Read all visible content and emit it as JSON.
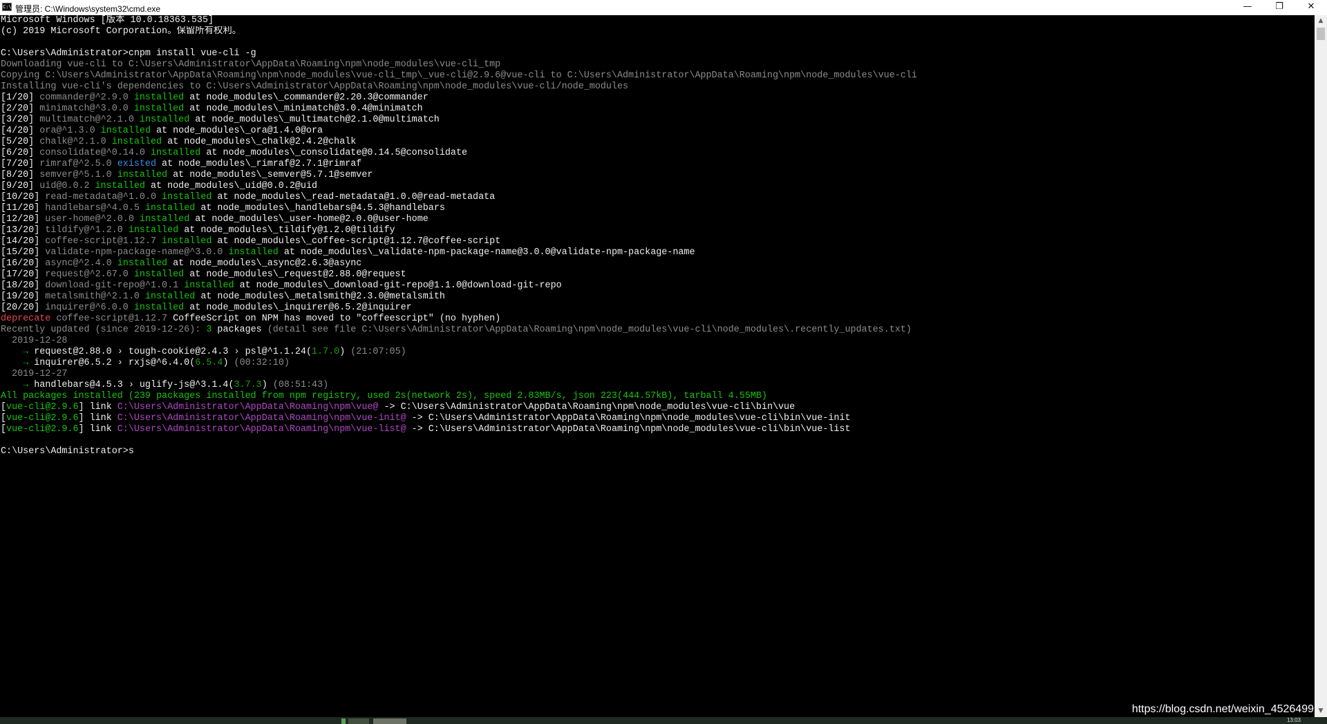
{
  "window": {
    "title": "管理员: C:\\Windows\\system32\\cmd.exe",
    "icon_name": "cmd-icon",
    "icon_glyph": "C:\\",
    "buttons": {
      "minimize": "—",
      "restore": "❐",
      "close": "✕"
    }
  },
  "colors": {
    "background": "#000000",
    "text_gray": "#8c8c8c",
    "text_white": "#f0f0f0",
    "green": "#16c60c",
    "blue": "#3b8eea",
    "red": "#e74856",
    "magenta": "#b148c6"
  },
  "console_lines": [
    [
      [
        "w",
        "Microsoft Windows [版本 10.0.18363.535]"
      ]
    ],
    [
      [
        "w",
        "(c) 2019 Microsoft Corporation。保留所有权利。"
      ]
    ],
    [],
    [
      [
        "w",
        "C:\\Users\\Administrator>cnpm install vue-cli -g"
      ]
    ],
    [
      [
        "d",
        "Downloading vue-cli to C:\\Users\\Administrator\\AppData\\Roaming\\npm\\node_modules\\vue-cli_tmp"
      ]
    ],
    [
      [
        "d",
        "Copying C:\\Users\\Administrator\\AppData\\Roaming\\npm\\node_modules\\vue-cli_tmp\\_vue-cli@2.9.6@vue-cli to C:\\Users\\Administrator\\AppData\\Roaming\\npm\\node_modules\\vue-cli"
      ]
    ],
    [
      [
        "d",
        "Installing vue-cli's dependencies to C:\\Users\\Administrator\\AppData\\Roaming\\npm\\node_modules\\vue-cli/node_modules"
      ]
    ],
    [
      [
        "w",
        "[1/20] "
      ],
      [
        "d",
        "commander@^2.9.0 "
      ],
      [
        "g",
        "installed"
      ],
      [
        "w",
        " at node_modules\\_commander@2.20.3@commander"
      ]
    ],
    [
      [
        "w",
        "[2/20] "
      ],
      [
        "d",
        "minimatch@^3.0.0 "
      ],
      [
        "g",
        "installed"
      ],
      [
        "w",
        " at node_modules\\_minimatch@3.0.4@minimatch"
      ]
    ],
    [
      [
        "w",
        "[3/20] "
      ],
      [
        "d",
        "multimatch@^2.1.0 "
      ],
      [
        "g",
        "installed"
      ],
      [
        "w",
        " at node_modules\\_multimatch@2.1.0@multimatch"
      ]
    ],
    [
      [
        "w",
        "[4/20] "
      ],
      [
        "d",
        "ora@^1.3.0 "
      ],
      [
        "g",
        "installed"
      ],
      [
        "w",
        " at node_modules\\_ora@1.4.0@ora"
      ]
    ],
    [
      [
        "w",
        "[5/20] "
      ],
      [
        "d",
        "chalk@^2.1.0 "
      ],
      [
        "g",
        "installed"
      ],
      [
        "w",
        " at node_modules\\_chalk@2.4.2@chalk"
      ]
    ],
    [
      [
        "w",
        "[6/20] "
      ],
      [
        "d",
        "consolidate@^0.14.0 "
      ],
      [
        "g",
        "installed"
      ],
      [
        "w",
        " at node_modules\\_consolidate@0.14.5@consolidate"
      ]
    ],
    [
      [
        "w",
        "[7/20] "
      ],
      [
        "d",
        "rimraf@^2.5.0 "
      ],
      [
        "b",
        "existed"
      ],
      [
        "w",
        " at node_modules\\_rimraf@2.7.1@rimraf"
      ]
    ],
    [
      [
        "w",
        "[8/20] "
      ],
      [
        "d",
        "semver@^5.1.0 "
      ],
      [
        "g",
        "installed"
      ],
      [
        "w",
        " at node_modules\\_semver@5.7.1@semver"
      ]
    ],
    [
      [
        "w",
        "[9/20] "
      ],
      [
        "d",
        "uid@0.0.2 "
      ],
      [
        "g",
        "installed"
      ],
      [
        "w",
        " at node_modules\\_uid@0.0.2@uid"
      ]
    ],
    [
      [
        "w",
        "[10/20] "
      ],
      [
        "d",
        "read-metadata@^1.0.0 "
      ],
      [
        "g",
        "installed"
      ],
      [
        "w",
        " at node_modules\\_read-metadata@1.0.0@read-metadata"
      ]
    ],
    [
      [
        "w",
        "[11/20] "
      ],
      [
        "d",
        "handlebars@^4.0.5 "
      ],
      [
        "g",
        "installed"
      ],
      [
        "w",
        " at node_modules\\_handlebars@4.5.3@handlebars"
      ]
    ],
    [
      [
        "w",
        "[12/20] "
      ],
      [
        "d",
        "user-home@^2.0.0 "
      ],
      [
        "g",
        "installed"
      ],
      [
        "w",
        " at node_modules\\_user-home@2.0.0@user-home"
      ]
    ],
    [
      [
        "w",
        "[13/20] "
      ],
      [
        "d",
        "tildify@^1.2.0 "
      ],
      [
        "g",
        "installed"
      ],
      [
        "w",
        " at node_modules\\_tildify@1.2.0@tildify"
      ]
    ],
    [
      [
        "w",
        "[14/20] "
      ],
      [
        "d",
        "coffee-script@1.12.7 "
      ],
      [
        "g",
        "installed"
      ],
      [
        "w",
        " at node_modules\\_coffee-script@1.12.7@coffee-script"
      ]
    ],
    [
      [
        "w",
        "[15/20] "
      ],
      [
        "d",
        "validate-npm-package-name@^3.0.0 "
      ],
      [
        "g",
        "installed"
      ],
      [
        "w",
        " at node_modules\\_validate-npm-package-name@3.0.0@validate-npm-package-name"
      ]
    ],
    [
      [
        "w",
        "[16/20] "
      ],
      [
        "d",
        "async@^2.4.0 "
      ],
      [
        "g",
        "installed"
      ],
      [
        "w",
        " at node_modules\\_async@2.6.3@async"
      ]
    ],
    [
      [
        "w",
        "[17/20] "
      ],
      [
        "d",
        "request@^2.67.0 "
      ],
      [
        "g",
        "installed"
      ],
      [
        "w",
        " at node_modules\\_request@2.88.0@request"
      ]
    ],
    [
      [
        "w",
        "[18/20] "
      ],
      [
        "d",
        "download-git-repo@^1.0.1 "
      ],
      [
        "g",
        "installed"
      ],
      [
        "w",
        " at node_modules\\_download-git-repo@1.1.0@download-git-repo"
      ]
    ],
    [
      [
        "w",
        "[19/20] "
      ],
      [
        "d",
        "metalsmith@^2.1.0 "
      ],
      [
        "g",
        "installed"
      ],
      [
        "w",
        " at node_modules\\_metalsmith@2.3.0@metalsmith"
      ]
    ],
    [
      [
        "w",
        "[20/20] "
      ],
      [
        "d",
        "inquirer@^6.0.0 "
      ],
      [
        "g",
        "installed"
      ],
      [
        "w",
        " at node_modules\\_inquirer@6.5.2@inquirer"
      ]
    ],
    [
      [
        "r",
        "deprecate"
      ],
      [
        "d",
        " coffee-script@1.12.7 "
      ],
      [
        "w",
        "CoffeeScript on NPM has moved to \"coffeescript\" (no hyphen)"
      ]
    ],
    [
      [
        "d",
        "Recently updated (since 2019-12-26): "
      ],
      [
        "g",
        "3"
      ],
      [
        "w",
        " packages"
      ],
      [
        "d",
        " (detail see file C:\\Users\\Administrator\\AppData\\Roaming\\npm\\node_modules\\vue-cli\\node_modules\\.recently_updates.txt)"
      ]
    ],
    [
      [
        "d",
        "  2019-12-28"
      ]
    ],
    [
      [
        "g",
        "    → "
      ],
      [
        "w",
        "request@2.88.0 › tough-cookie@2.4.3 › psl@^1.1.24("
      ],
      [
        "dg",
        "1.7.0"
      ],
      [
        "w",
        ") "
      ],
      [
        "d",
        "(21:07:05)"
      ]
    ],
    [
      [
        "g",
        "    → "
      ],
      [
        "w",
        "inquirer@6.5.2 › rxjs@^6.4.0("
      ],
      [
        "dg",
        "6.5.4"
      ],
      [
        "w",
        ") "
      ],
      [
        "d",
        "(00:32:10)"
      ]
    ],
    [
      [
        "d",
        "  2019-12-27"
      ]
    ],
    [
      [
        "g",
        "    → "
      ],
      [
        "w",
        "handlebars@4.5.3 › uglify-js@^3.1.4("
      ],
      [
        "dg",
        "3.7.3"
      ],
      [
        "w",
        ") "
      ],
      [
        "d",
        "(08:51:43)"
      ]
    ],
    [
      [
        "g",
        "All packages installed (239 packages installed from npm registry, used 2s(network 2s), speed 2.83MB/s, json 223(444.57kB), tarball 4.55MB)"
      ]
    ],
    [
      [
        "w",
        "["
      ],
      [
        "g",
        "vue-cli@2.9.6"
      ],
      [
        "w",
        "] link "
      ],
      [
        "m",
        "C:\\Users\\Administrator\\AppData\\Roaming\\npm\\vue@"
      ],
      [
        "w",
        " -> C:\\Users\\Administrator\\AppData\\Roaming\\npm\\node_modules\\vue-cli\\bin\\vue"
      ]
    ],
    [
      [
        "w",
        "["
      ],
      [
        "g",
        "vue-cli@2.9.6"
      ],
      [
        "w",
        "] link "
      ],
      [
        "m",
        "C:\\Users\\Administrator\\AppData\\Roaming\\npm\\vue-init@"
      ],
      [
        "w",
        " -> C:\\Users\\Administrator\\AppData\\Roaming\\npm\\node_modules\\vue-cli\\bin\\vue-init"
      ]
    ],
    [
      [
        "w",
        "["
      ],
      [
        "g",
        "vue-cli@2.9.6"
      ],
      [
        "w",
        "] link "
      ],
      [
        "m",
        "C:\\Users\\Administrator\\AppData\\Roaming\\npm\\vue-list@"
      ],
      [
        "w",
        " -> C:\\Users\\Administrator\\AppData\\Roaming\\npm\\node_modules\\vue-cli\\bin\\vue-list"
      ]
    ],
    [],
    [
      [
        "w",
        "C:\\Users\\Administrator>s"
      ]
    ]
  ],
  "scrollbar": {
    "up_arrow": "▲",
    "down_arrow": "▼",
    "up_icon_name": "scroll-up-arrow-icon",
    "down_icon_name": "scroll-down-arrow-icon"
  },
  "watermark": "https://blog.csdn.net/weixin_4526499",
  "taskbar": {
    "clock": "13:03"
  }
}
